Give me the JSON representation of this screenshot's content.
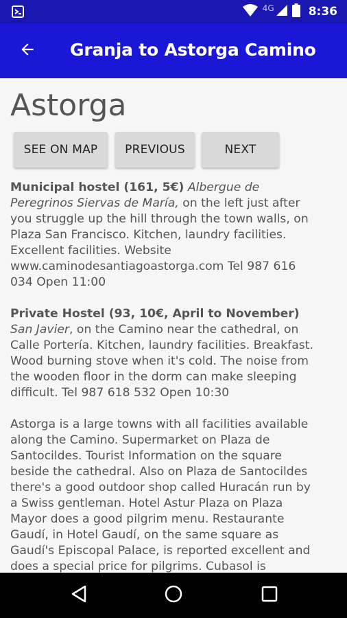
{
  "status_bar": {
    "network_label": "4G",
    "time": "8:36"
  },
  "app_bar": {
    "title": "Granja to Astorga Camino"
  },
  "page": {
    "title": "Astorga"
  },
  "buttons": {
    "see_on_map": "SEE ON MAP",
    "previous": "PREVIOUS",
    "next": "NEXT"
  },
  "content": {
    "p1_bold": "Municipal hostel (161, 5€)",
    "p1_italic": "Albergue de Peregrinos Siervas de María,",
    "p1_rest": " on the left just after you struggle up the hill through the town walls, on Plaza San Francisco. Kitchen, laundry facilities. Excellent facilities. Website www.caminodesantiagoastorga.com Tel 987 616 034 Open 11:00",
    "p2_bold": "Private Hostel (93, 10€, April to November)",
    "p2_italic": "San Javier",
    "p2_rest": ", on the Camino near the cathedral, on Calle Portería. Kitchen, laundry facilities. Breakfast. Wood burning stove when it's cold. The noise from the wooden floor in the dorm can make sleeping difficult. Tel 987 618 532 Open 10:30",
    "p3": "Astorga is a large towns with all facilities available along the Camino. Supermarket on Plaza de Santocildes. Tourist Information on the square beside the cathedral. Also on Plaza de Santocildes there's a good outdoor shop called Huracán run by a Swiss gentleman. Hotel Astur Plaza on Plaza Mayor does a good pilgrim menu. Restaurante Gaudí, in Hotel Gaudí, on the same square as Gaudí's Episcopal Palace, is reported excellent and does a special price for pilgrims. Cubasol is"
  },
  "colors": {
    "status_bar": "#1a17b3",
    "app_bar": "#1a17d6",
    "background": "#f6f6f6",
    "text": "#555555",
    "button": "#d9d9d9"
  },
  "icons": {
    "status_left": "android-debug-icon",
    "wifi": "wifi-icon",
    "signal": "cell-signal-icon",
    "battery": "battery-icon",
    "back": "arrow-back-icon",
    "nav_back": "nav-back-icon",
    "nav_home": "nav-home-icon",
    "nav_recents": "nav-recents-icon"
  }
}
